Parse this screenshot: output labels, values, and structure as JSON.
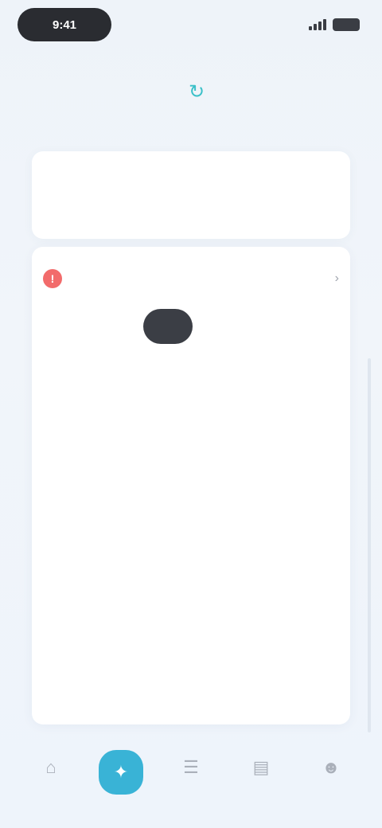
{
  "status_bar": {
    "time": "9:41"
  },
  "top_nav": {
    "left_label": "",
    "center_icon": "refresh-icon",
    "right_label": ""
  },
  "banner": {
    "text": ""
  },
  "main_card": {
    "title": "",
    "header_value": "",
    "tabs": [
      "",
      "",
      "",
      "",
      "",
      ""
    ],
    "active_tab": 2,
    "subtitle": "",
    "empty_text": "",
    "footer_text": ""
  },
  "bottom_nav": {
    "items": [
      {
        "label": "",
        "icon": "home-icon"
      },
      {
        "label": "",
        "icon": "compass-icon"
      },
      {
        "label": "",
        "icon": "list-icon"
      },
      {
        "label": "",
        "icon": "chart-icon"
      },
      {
        "label": "",
        "icon": "user-icon"
      }
    ],
    "active_index": 1
  },
  "colors": {
    "accent": "#39b3d6",
    "alert": "#f26b6b",
    "dark_pill": "#3b3e45",
    "teal_icon": "#3ac0c8"
  }
}
